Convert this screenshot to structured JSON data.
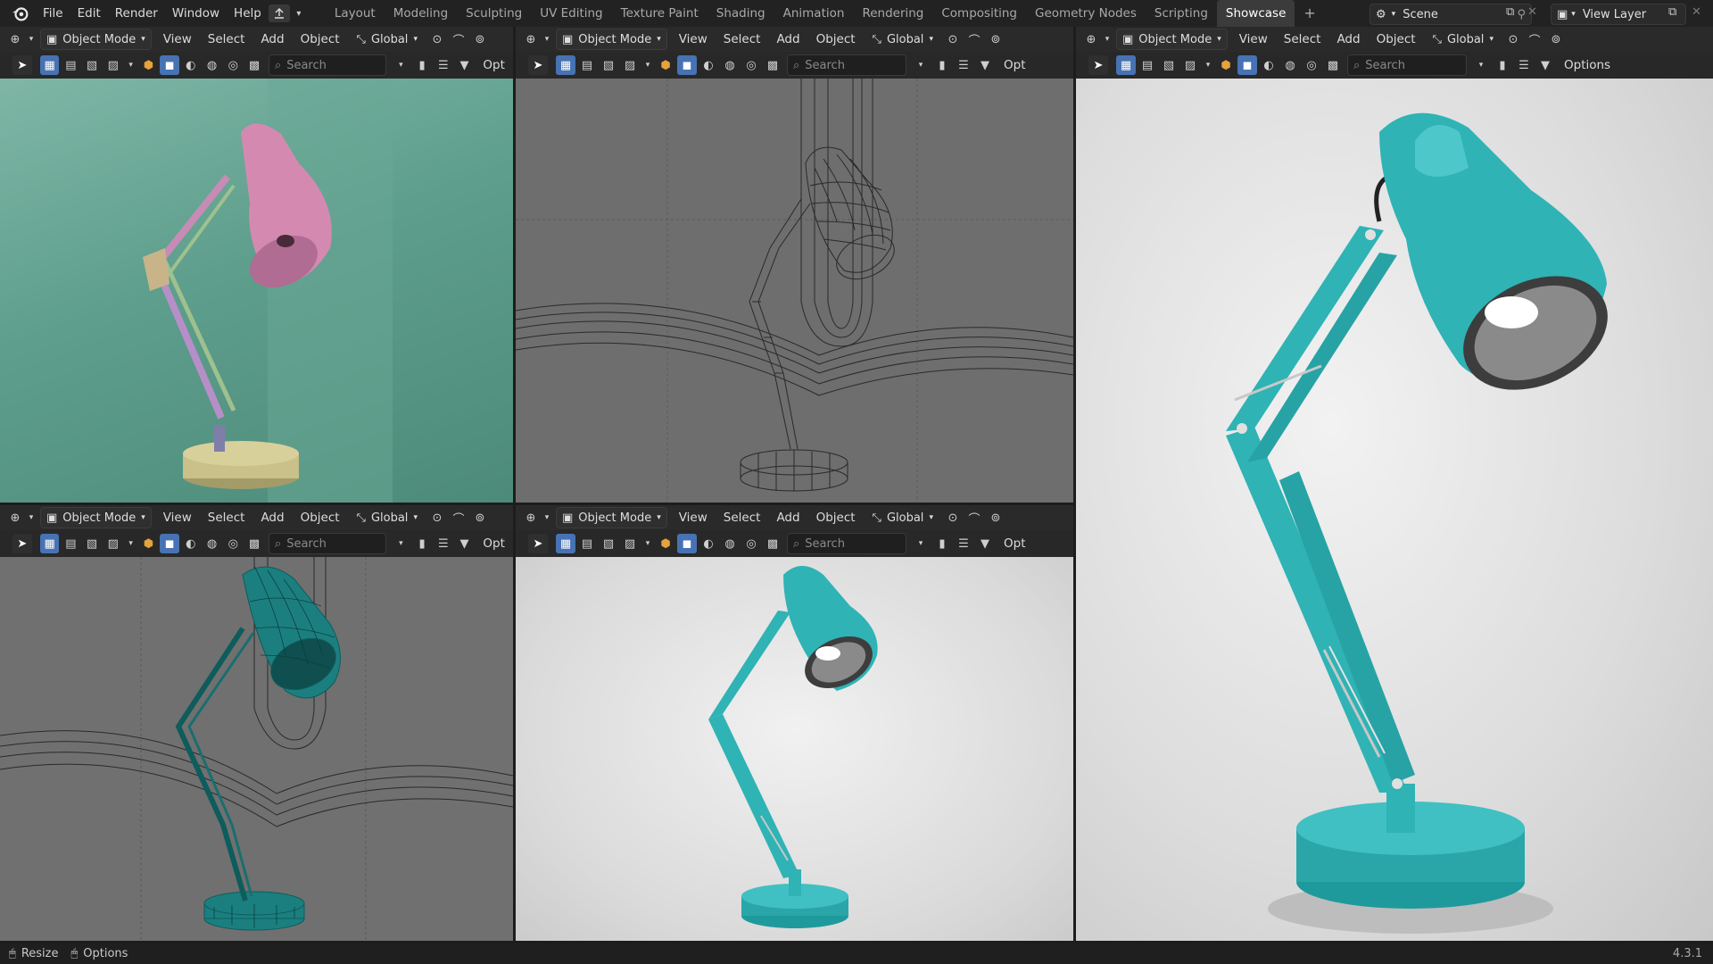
{
  "menu": {
    "file": "File",
    "edit": "Edit",
    "render": "Render",
    "window": "Window",
    "help": "Help"
  },
  "workspaces": [
    "Layout",
    "Modeling",
    "Sculpting",
    "UV Editing",
    "Texture Paint",
    "Shading",
    "Animation",
    "Rendering",
    "Compositing",
    "Geometry Nodes",
    "Scripting",
    "Showcase"
  ],
  "active_workspace": "Showcase",
  "scene": {
    "name": "Scene"
  },
  "view_layer": {
    "name": "View Layer"
  },
  "viewport_header": {
    "mode": "Object Mode",
    "view": "View",
    "select": "Select",
    "add": "Add",
    "object": "Object",
    "orientation": "Global",
    "search_placeholder": "Search",
    "options_short": "Opt",
    "options": "Options"
  },
  "status": {
    "resize": "Resize",
    "options": "Options",
    "version": "4.3.1"
  },
  "colors": {
    "lamp_teal": "#2fb3b5",
    "lamp_pink": "#d48ab0",
    "lamp_base_tan": "#c9c08a",
    "viewport_green": "#5e9e8c",
    "selection_blue": "#4772b3"
  }
}
